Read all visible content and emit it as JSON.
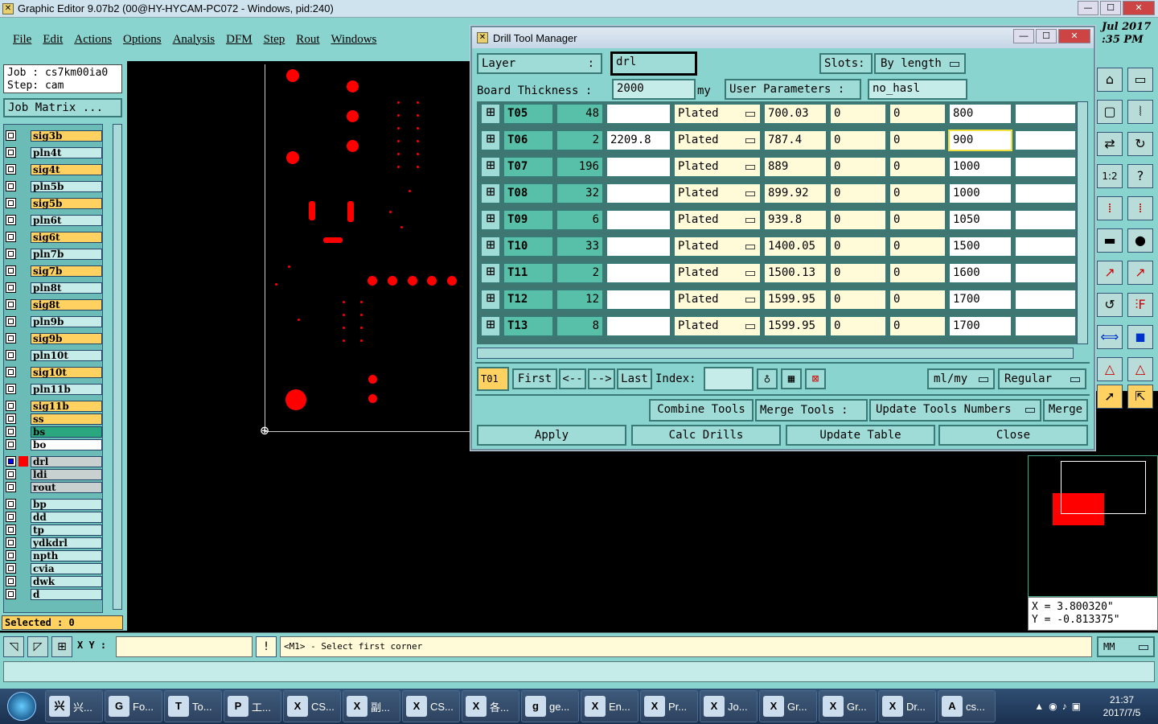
{
  "app": {
    "title": "Graphic Editor 9.07b2 (00@HY-HYCAM-PC072 - Windows, pid:240)"
  },
  "menu": [
    "File",
    "Edit",
    "Actions",
    "Options",
    "Analysis",
    "DFM",
    "Step",
    "Rout",
    "Windows"
  ],
  "job": {
    "line1": "Job : cs7km00ia0",
    "line2": "Step: cam",
    "matrix_btn": "Job Matrix ..."
  },
  "layers": [
    "sig3b",
    "pln4t",
    "sig4t",
    "pln5b",
    "sig5b",
    "pln6t",
    "sig6t",
    "pln7b",
    "sig7b",
    "pln8t",
    "sig8t",
    "pln9b",
    "sig9b",
    "pln10t",
    "sig10t",
    "pln11b",
    "sig11b",
    "ss",
    "bs",
    "bo",
    "drl",
    "ldi",
    "rout",
    "bp",
    "dd",
    "tp",
    "ydkdrl",
    "npth",
    "cvia",
    "dwk",
    "d"
  ],
  "selected": "Selected : 0",
  "dialog": {
    "title": "Drill Tool Manager",
    "layer_label": "Layer",
    "layer_value": "drl",
    "slots_label": "Slots:",
    "slots_value": "By length",
    "board_label": "Board Thickness :",
    "board_value": "2000",
    "board_unit": "my",
    "user_params_label": "User Parameters :",
    "user_params_value": "no_hasl",
    "rows": [
      {
        "tool": "T05",
        "count": "48",
        "c1": "",
        "type": "Plated",
        "size": "700.03",
        "a": "0",
        "b": "0",
        "fin": "800"
      },
      {
        "tool": "T06",
        "count": "2",
        "c1": "2209.8",
        "type": "Plated",
        "size": "787.4",
        "a": "0",
        "b": "0",
        "fin": "900"
      },
      {
        "tool": "T07",
        "count": "196",
        "c1": "",
        "type": "Plated",
        "size": "889",
        "a": "0",
        "b": "0",
        "fin": "1000"
      },
      {
        "tool": "T08",
        "count": "32",
        "c1": "",
        "type": "Plated",
        "size": "899.92",
        "a": "0",
        "b": "0",
        "fin": "1000"
      },
      {
        "tool": "T09",
        "count": "6",
        "c1": "",
        "type": "Plated",
        "size": "939.8",
        "a": "0",
        "b": "0",
        "fin": "1050"
      },
      {
        "tool": "T10",
        "count": "33",
        "c1": "",
        "type": "Plated",
        "size": "1400.05",
        "a": "0",
        "b": "0",
        "fin": "1500"
      },
      {
        "tool": "T11",
        "count": "2",
        "c1": "",
        "type": "Plated",
        "size": "1500.13",
        "a": "0",
        "b": "0",
        "fin": "1600"
      },
      {
        "tool": "T12",
        "count": "12",
        "c1": "",
        "type": "Plated",
        "size": "1599.95",
        "a": "0",
        "b": "0",
        "fin": "1700"
      },
      {
        "tool": "T13",
        "count": "8",
        "c1": "",
        "type": "Plated",
        "size": "1599.95",
        "a": "0",
        "b": "0",
        "fin": "1700"
      }
    ],
    "nav": {
      "current": "T01",
      "first": "First",
      "prev": "<--",
      "next": "-->",
      "last": "Last",
      "index_label": "Index:",
      "units": "ml/my",
      "mode": "Regular"
    },
    "tools_row": {
      "combine": "Combine Tools",
      "merge_label": "Merge Tools :",
      "update_numbers": "Update Tools Numbers",
      "merge": "Merge"
    },
    "actions": {
      "apply": "Apply",
      "calc": "Calc Drills",
      "update": "Update Table",
      "close": "Close"
    }
  },
  "coords": {
    "x": "X = 3.800320\"",
    "y": "Y = -0.813375\""
  },
  "status": {
    "xy_label": "X Y :",
    "prompt": "<M1> - Select first corner",
    "units": "MM"
  },
  "clock": {
    "time": "21:37",
    "date": "2017/7/5",
    "bg_date": "Jul 2017",
    "bg_time": ":35 PM"
  },
  "taskbar": [
    {
      "icon": "兴",
      "label": "兴..."
    },
    {
      "icon": "G",
      "label": "Fo..."
    },
    {
      "icon": "T",
      "label": "To..."
    },
    {
      "icon": "P",
      "label": "工..."
    },
    {
      "icon": "X",
      "label": "CS..."
    },
    {
      "icon": "X",
      "label": "副..."
    },
    {
      "icon": "X",
      "label": "CS..."
    },
    {
      "icon": "X",
      "label": "各..."
    },
    {
      "icon": "g",
      "label": "ge..."
    },
    {
      "icon": "X",
      "label": "En..."
    },
    {
      "icon": "X",
      "label": "Pr..."
    },
    {
      "icon": "X",
      "label": "Jo..."
    },
    {
      "icon": "X",
      "label": "Gr..."
    },
    {
      "icon": "X",
      "label": "Gr..."
    },
    {
      "icon": "X",
      "label": "Dr..."
    },
    {
      "icon": "A",
      "label": "cs..."
    }
  ],
  "colors": {
    "panel": "#8ad4d0",
    "accent_orange": "#ffd160",
    "drill": "#ff0000"
  }
}
